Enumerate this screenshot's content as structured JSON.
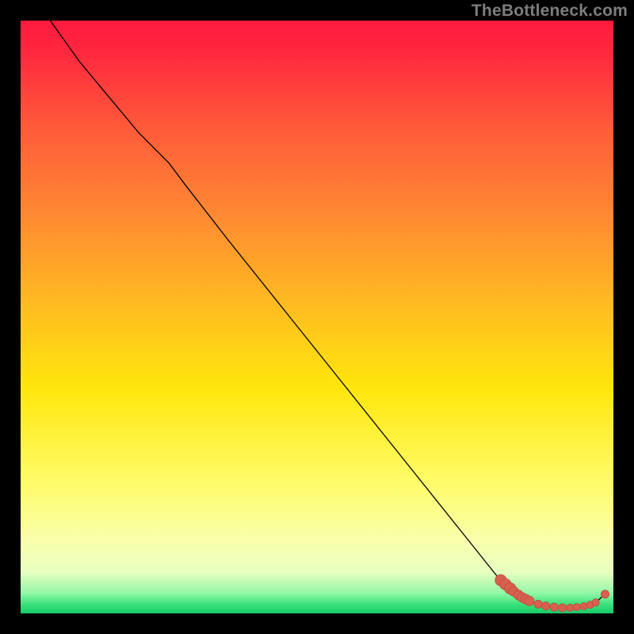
{
  "watermark": "TheBottleneck.com",
  "colors": {
    "frame": "#000000",
    "line": "#000000",
    "point_fill": "#d7604f",
    "point_stroke": "#c04e3f",
    "gradient_stops": [
      {
        "offset": 0.0,
        "color": "#ff1a3e"
      },
      {
        "offset": 0.06,
        "color": "#ff2a3e"
      },
      {
        "offset": 0.18,
        "color": "#ff5a3a"
      },
      {
        "offset": 0.33,
        "color": "#ff8a32"
      },
      {
        "offset": 0.5,
        "color": "#ffc21e"
      },
      {
        "offset": 0.62,
        "color": "#ffe60c"
      },
      {
        "offset": 0.78,
        "color": "#fffc6a"
      },
      {
        "offset": 0.88,
        "color": "#f8ffae"
      },
      {
        "offset": 0.93,
        "color": "#e8ffc0"
      },
      {
        "offset": 0.965,
        "color": "#95f7a8"
      },
      {
        "offset": 0.985,
        "color": "#39e27a"
      },
      {
        "offset": 1.0,
        "color": "#18c96a"
      }
    ]
  },
  "chart_data": {
    "type": "line",
    "title": "",
    "xlabel": "",
    "ylabel": "",
    "xlim": [
      0,
      100
    ],
    "ylim": [
      0,
      100
    ],
    "series": [
      {
        "name": "curve",
        "x": [
          5,
          10,
          15,
          20,
          25,
          28,
          35,
          45,
          55,
          65,
          75,
          81,
          82.5,
          84,
          85,
          86,
          89,
          92,
          95,
          97,
          98.5
        ],
        "y": [
          100,
          93,
          87,
          81,
          76,
          72,
          63,
          50.5,
          38,
          25.5,
          13,
          5.5,
          4,
          3,
          2.4,
          1.9,
          1.2,
          0.9,
          1.1,
          1.8,
          3.2
        ]
      }
    ],
    "points": {
      "name": "cluster",
      "x": [
        81.0,
        81.8,
        82.6,
        83.2,
        84.0,
        84.6,
        85.2,
        85.8,
        87.3,
        88.6,
        90.0,
        91.4,
        92.7,
        93.8,
        95.0,
        96.1,
        97.0,
        98.6
      ],
      "y": [
        5.6,
        4.9,
        4.2,
        3.7,
        3.1,
        2.7,
        2.4,
        2.1,
        1.55,
        1.25,
        1.05,
        0.95,
        0.95,
        1.05,
        1.2,
        1.45,
        1.85,
        3.25
      ],
      "r": [
        7,
        7,
        7,
        6,
        6,
        6,
        6,
        6,
        5,
        5,
        5,
        5,
        4.5,
        4.5,
        4.5,
        4.5,
        4.5,
        5
      ]
    }
  }
}
